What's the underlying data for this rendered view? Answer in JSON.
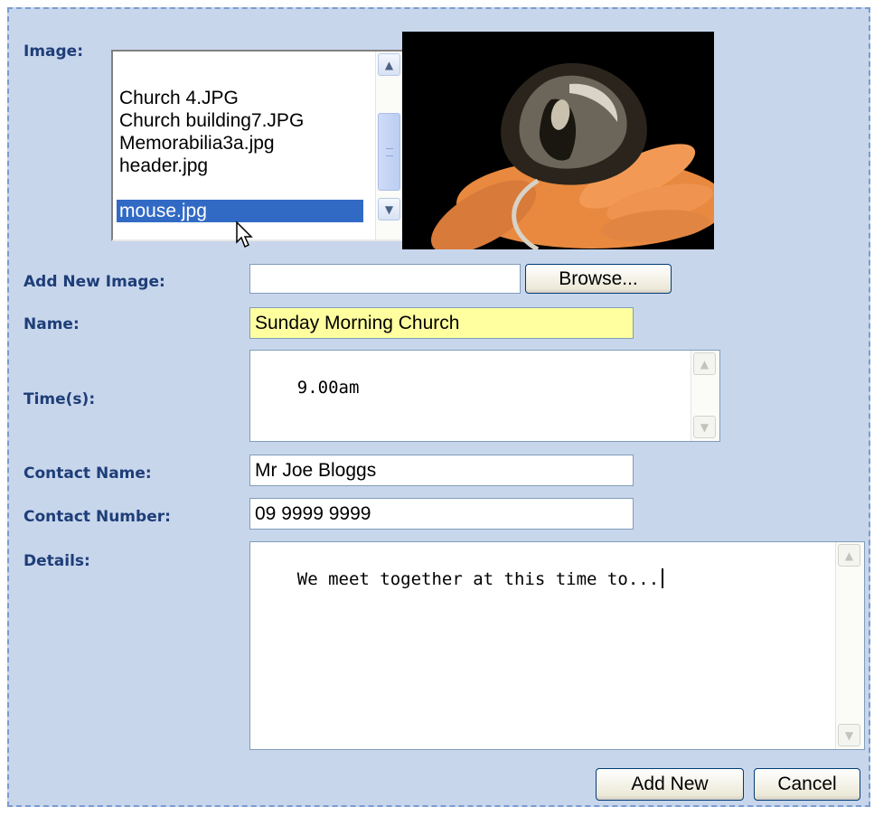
{
  "form": {
    "image_label": "Image:",
    "image_options": [
      {
        "label": "Church 4.JPG",
        "selected": false
      },
      {
        "label": "Church building7.JPG",
        "selected": false
      },
      {
        "label": "Memorabilia3a.jpg",
        "selected": false
      },
      {
        "label": "header.jpg",
        "selected": false
      },
      {
        "label": "mouse.jpg",
        "selected": true
      }
    ],
    "add_new_image_label": "Add New Image:",
    "add_new_image_value": "",
    "browse_button": "Browse...",
    "name_label": "Name:",
    "name_value": "Sunday Morning Church",
    "times_label": "Time(s):",
    "times_value": "9.00am",
    "contact_name_label": "Contact Name:",
    "contact_name_value": "Mr Joe Bloggs",
    "contact_number_label": "Contact Number:",
    "contact_number_value": "09 9999 9999",
    "details_label": "Details:",
    "details_value": "We meet together at this time to...",
    "add_button": "Add New",
    "cancel_button": "Cancel"
  },
  "colors": {
    "panel_bg": "#c8d6ec",
    "label_text": "#1e3e78",
    "selection": "#316ac5",
    "focused_field": "#ffffa0"
  }
}
